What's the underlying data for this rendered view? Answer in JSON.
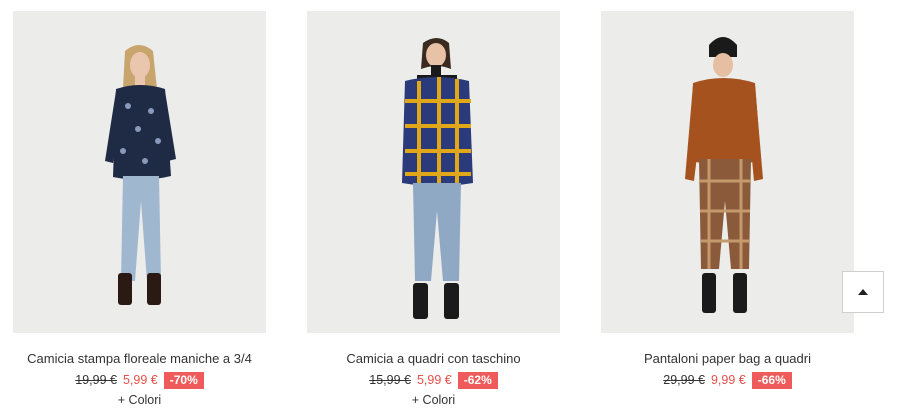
{
  "products": [
    {
      "name": "Camicia stampa floreale maniche a 3/4",
      "old_price": "19,99 €",
      "new_price": "5,99 €",
      "discount": "-70%",
      "colors_link": "+ Colori"
    },
    {
      "name": "Camicia a quadri con taschino",
      "old_price": "15,99 €",
      "new_price": "5,99 €",
      "discount": "-62%",
      "colors_link": "+ Colori"
    },
    {
      "name": "Pantaloni paper bag a quadri",
      "old_price": "29,99 €",
      "new_price": "9,99 €",
      "discount": "-66%"
    }
  ],
  "scroll_top": {
    "icon": "arrow-up-icon"
  },
  "colors": {
    "sale": "#e4504a",
    "badge": "#ef5a5a",
    "photo_bg": "#ececea"
  }
}
